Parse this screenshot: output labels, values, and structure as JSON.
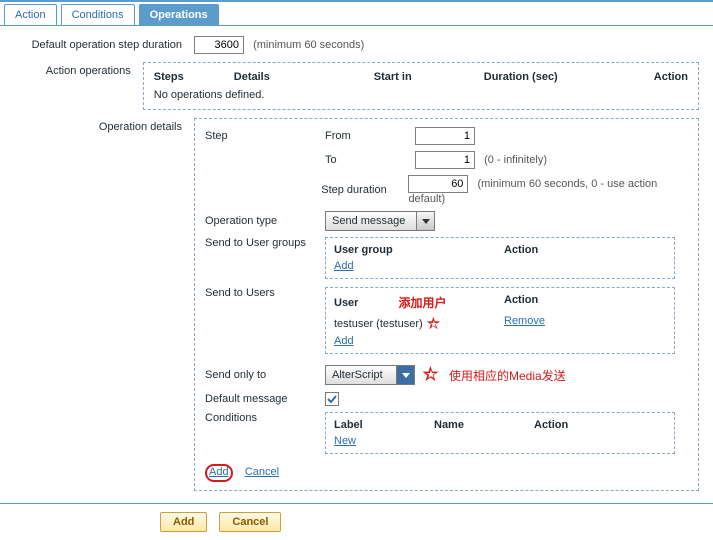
{
  "tabs": {
    "action": "Action",
    "conditions": "Conditions",
    "operations": "Operations"
  },
  "labels": {
    "default_step_duration": "Default operation step duration",
    "min60": "(minimum 60 seconds)",
    "action_operations": "Action operations",
    "operation_details": "Operation details"
  },
  "values": {
    "default_step_duration": "3600"
  },
  "ops_table": {
    "h_steps": "Steps",
    "h_details": "Details",
    "h_start": "Start in",
    "h_duration": "Duration (sec)",
    "h_action": "Action",
    "empty": "No operations defined."
  },
  "details": {
    "step_label": "Step",
    "from_label": "From",
    "from_val": "1",
    "to_label": "To",
    "to_val": "1",
    "to_hint": "(0 - infinitely)",
    "dur_label": "Step duration",
    "dur_val": "60",
    "dur_hint": "(minimum 60 seconds, 0 - use action default)",
    "op_type_label": "Operation type",
    "op_type_val": "Send message",
    "groups_label": "Send to User groups",
    "groups_h1": "User group",
    "groups_h2": "Action",
    "add_link": "Add",
    "users_label": "Send to Users",
    "users_h1": "User",
    "users_h2": "Action",
    "user0": "testuser (testuser)",
    "remove_link": "Remove",
    "send_only_label": "Send only to",
    "send_only_val": "AlterScript",
    "default_msg_label": "Default message",
    "conditions_label": "Conditions",
    "cond_h1": "Label",
    "cond_h2": "Name",
    "cond_h3": "Action",
    "new_link": "New",
    "cancel_link": "Cancel"
  },
  "annotations": {
    "add_user": "添加用户",
    "media_send": "使用相应的Media发送"
  },
  "footer": {
    "add": "Add",
    "cancel": "Cancel"
  }
}
